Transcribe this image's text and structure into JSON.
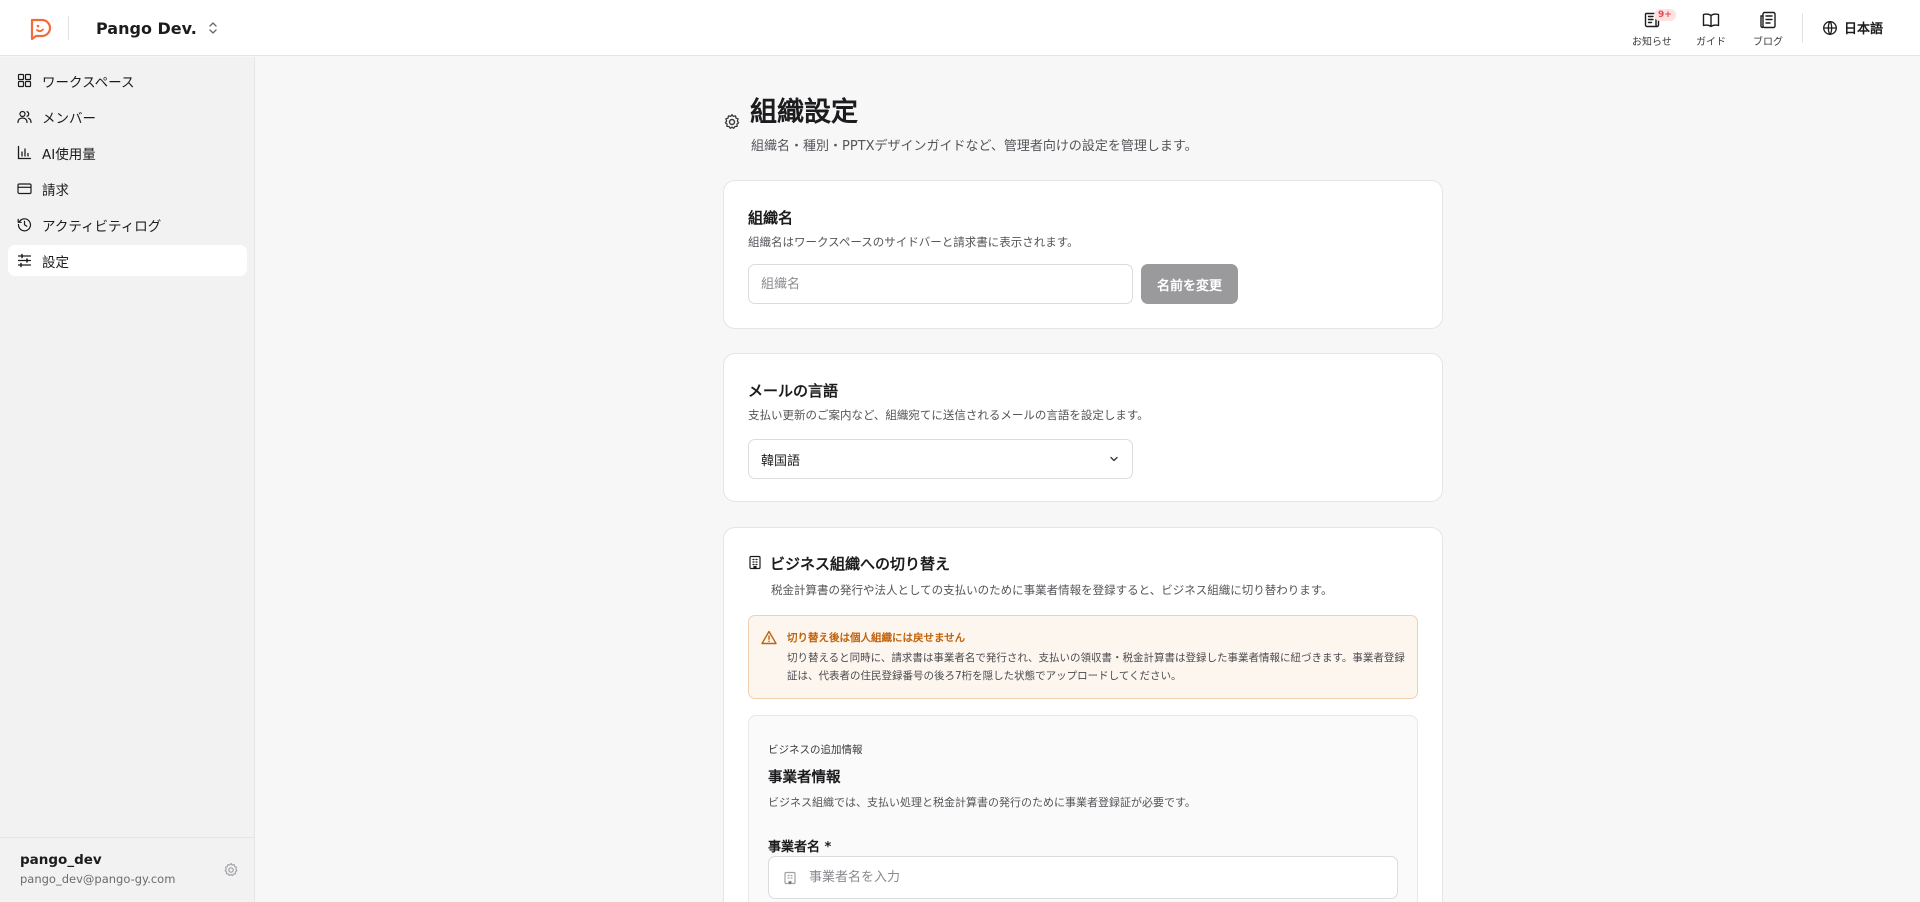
{
  "header": {
    "org_name": "Pango Dev.",
    "notices": {
      "label": "お知らせ",
      "badge": "9+"
    },
    "guide": {
      "label": "ガイド"
    },
    "blog": {
      "label": "ブログ"
    },
    "language": "日本語"
  },
  "sidebar": {
    "items": [
      {
        "label": "ワークスペース",
        "icon": "grid-icon"
      },
      {
        "label": "メンバー",
        "icon": "users-icon"
      },
      {
        "label": "AI使用量",
        "icon": "bar-chart-icon"
      },
      {
        "label": "請求",
        "icon": "credit-card-icon"
      },
      {
        "label": "アクティビティログ",
        "icon": "history-icon"
      },
      {
        "label": "設定",
        "icon": "sliders-icon",
        "active": true
      }
    ],
    "user": {
      "name": "pango_dev",
      "email": "pango_dev@pango-gy.com"
    }
  },
  "page": {
    "title": "組織設定",
    "subtitle": "組織名・種別・PPTXデザインガイドなど、管理者向けの設定を管理します。"
  },
  "org_name_card": {
    "title": "組織名",
    "description": "組織名はワークスペースのサイドバーと請求書に表示されます。",
    "input_placeholder": "組織名",
    "input_value": "",
    "button_label": "名前を変更"
  },
  "email_lang_card": {
    "title": "メールの言語",
    "description": "支払い更新のご案内など、組織宛てに送信されるメールの言語を設定します。",
    "selected": "韓国語"
  },
  "business_card": {
    "title": "ビジネス組織への切り替え",
    "description": "税金計算書の発行や法人としての支払いのために事業者情報を登録すると、ビジネス組織に切り替わります。",
    "warning": {
      "title": "切り替え後は個人組織には戻せません",
      "text": "切り替えると同時に、請求書は事業者名で発行され、支払いの領収書・税金計算書は登録した事業者情報に紐づきます。事業者登録証は、代表者の住民登録番号の後ろ7桁を隠した状態でアップロードしてください。"
    },
    "section": {
      "eyebrow": "ビジネスの追加情報",
      "title": "事業者情報",
      "description": "ビジネス組織では、支払い処理と税金計算書の発行のために事業者登録証が必要です。",
      "field_label": "事業者名 *",
      "field_placeholder": "事業者名を入力"
    }
  },
  "colors": {
    "accent": "#f26b3a",
    "warning": "#c2620a",
    "disabled_button": "#9a9a9c"
  }
}
